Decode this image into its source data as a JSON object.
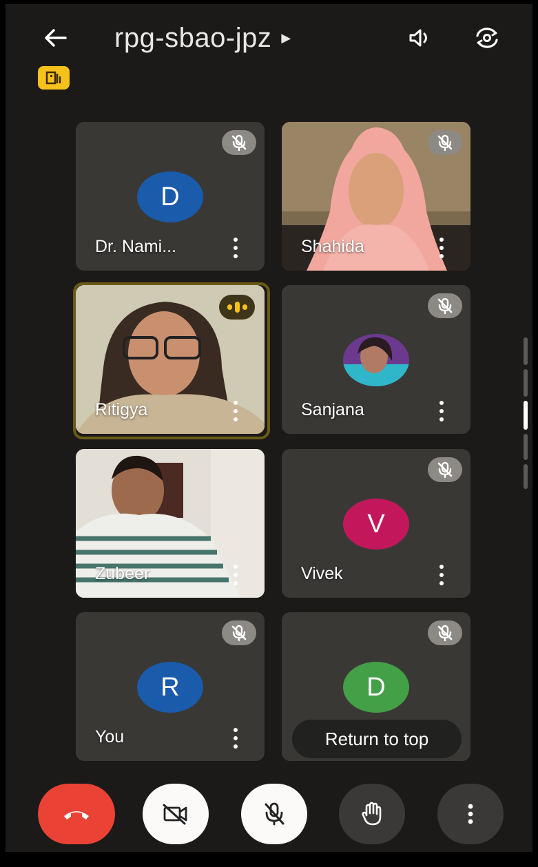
{
  "header": {
    "meeting_code": "rpg-sbao-jpz",
    "icons": [
      "back-arrow-icon",
      "speaker-icon",
      "switch-camera-icon",
      "meeting-info-icon"
    ]
  },
  "participants": [
    {
      "name": "Dr. Nami...",
      "initial": "D",
      "avatar_color": "#1a5bab",
      "muted": true,
      "video": false
    },
    {
      "name": "Shahida",
      "muted": true,
      "video": true
    },
    {
      "name": "Ritigya",
      "muted": false,
      "speaking": true,
      "video": true
    },
    {
      "name": "Sanjana",
      "muted": true,
      "video": false,
      "photo_avatar": true
    },
    {
      "name": "Zubeer",
      "muted": false,
      "video": true
    },
    {
      "name": "Vivek",
      "initial": "V",
      "avatar_color": "#c2185b",
      "muted": true,
      "video": false
    },
    {
      "name": "You",
      "initial": "R",
      "avatar_color": "#1a5bab",
      "muted": true,
      "video": false
    },
    {
      "name": "",
      "initial": "D",
      "avatar_color": "#43a047",
      "muted": true,
      "video": false
    }
  ],
  "return_to_top_label": "Return to top",
  "controls": {
    "icons": [
      "end-call-icon",
      "camera-off-icon",
      "mic-off-icon",
      "raise-hand-icon",
      "more-options-icon"
    ]
  },
  "colors": {
    "background": "#1b1a18",
    "tile": "#3a3835",
    "end_call": "#ea4335",
    "speaking_accent": "#f7c11b"
  }
}
